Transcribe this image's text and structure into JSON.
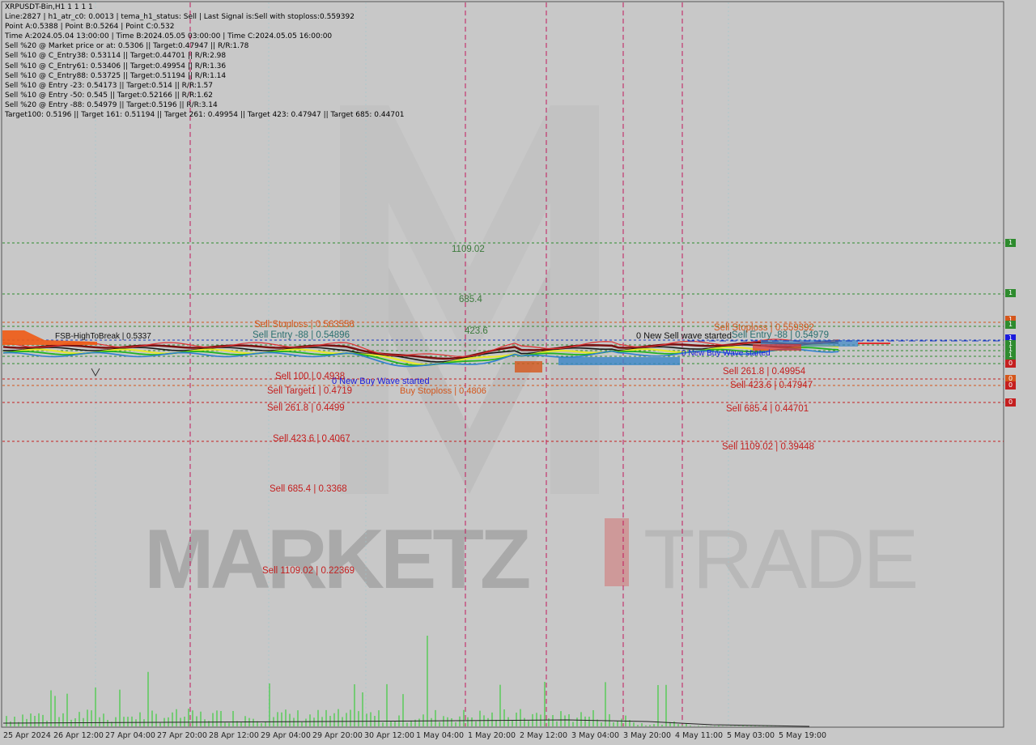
{
  "header": {
    "lines": [
      "XRPUSDT-Bin,H1  1 1 1 1",
      "Line:2827  |  h1_atr_c0: 0.0013  |  tema_h1_status: Sell  |  Last Signal is:Sell with stoploss:0.559392",
      "Point A:0.5388  |  Point B:0.5264  |  Point C:0.532",
      "Time A:2024.05.04 13:00:00  |  Time B:2024.05.05 03:00:00  |  Time C:2024.05.05 16:00:00",
      "Sell %20 @ Market price or at: 0.5306  ||  Target:0.47947  ||  R/R:1.78",
      "Sell %10 @ C_Entry38: 0.53114  ||  Target:0.44701  ||  R/R:2.98",
      "Sell %10 @ C_Entry61: 0.53406  ||  Target:0.49954  ||  R/R:1.36",
      "Sell %10 @ C_Entry88: 0.53725  ||  Target:0.51194  ||  R/R:1.14",
      "Sell %10 @ Entry -23: 0.54173  ||  Target:0.514  ||  R/R:1.57",
      "Sell %10 @ Entry -50: 0.545  ||  Target:0.52166  ||  R/R:1.62",
      "Sell %20 @ Entry -88: 0.54979  ||  Target:0.5196  ||  R/R:3.14",
      "Target100: 0.5196  ||  Target 161: 0.51194  ||  Target 261: 0.49954  ||  Target 423: 0.47947  ||  Target 685: 0.44701"
    ]
  },
  "levels_left": {
    "l1109": "1109.02",
    "l685": "685.4",
    "l423": "423.6",
    "stoploss": "Sell Stoploss | 0.563556",
    "entry88": "Sell Entry -88 | 0.54896",
    "fsb": "FSB-HighToBreak  |  0.5337",
    "sell100": "Sell 100 | 0.4938",
    "target1": "Sell Target1 | 0.4719",
    "sell261": "Sell  261.8 | 0.4499",
    "sell423": "Sell  423.6 | 0.4067",
    "sell685": "Sell  685.4 | 0.3368",
    "sell1109": "Sell 1109.02 | 0.22369",
    "newbuy": "0 New Buy Wave started",
    "buystoploss": "Buy Stoploss | 0.4806"
  },
  "levels_right": {
    "stoploss": "Sell Stoploss | 0.559392",
    "entry": "Sell Entry -88 | 0.54979",
    "newsell": "0 New Sell wave started",
    "sell261": "Sell  261.8 | 0.49954",
    "sell423": "Sell  423.6 | 0.47947",
    "sell685": "Sell  685.4 | 0.44701",
    "sell1109": "Sell 1109.02 | 0.39448",
    "newbuy": "0 New Buy Wave started"
  },
  "price_markers": [
    {
      "label": "1",
      "color": "#2e8b2e"
    },
    {
      "label": "1",
      "color": "#2e8b2e"
    },
    {
      "label": "1",
      "color": "#d4561b"
    },
    {
      "label": "1",
      "color": "#2e8b2e"
    },
    {
      "label": "1",
      "color": "#1a1adc"
    },
    {
      "label": "1",
      "color": "#2e8b2e"
    },
    {
      "label": "1",
      "color": "#2e8b2e"
    },
    {
      "label": "1",
      "color": "#2e8b2e"
    },
    {
      "label": "0",
      "color": "#c41f1f"
    },
    {
      "label": "0",
      "color": "#d4561b"
    },
    {
      "label": "0",
      "color": "#c41f1f"
    },
    {
      "label": "0",
      "color": "#c41f1f"
    }
  ],
  "x_axis": [
    "25 Apr 2024",
    "26 Apr 12:00",
    "27 Apr 04:00",
    "27 Apr 20:00",
    "28 Apr 12:00",
    "29 Apr 04:00",
    "29 Apr 20:00",
    "30 Apr 12:00",
    "1 May 04:00",
    "1 May 20:00",
    "2 May 12:00",
    "3 May 04:00",
    "3 May 20:00",
    "4 May 11:00",
    "5 May 03:00",
    "5 May 19:00"
  ],
  "watermark": {
    "part1": "MARKETZ",
    "part2": "TRADE"
  },
  "colors": {
    "background": "#c8c8c8",
    "sell": "#c41f1f",
    "accent": "#d4561b",
    "magenta": "#c2185b",
    "volume": "#22cc22"
  }
}
